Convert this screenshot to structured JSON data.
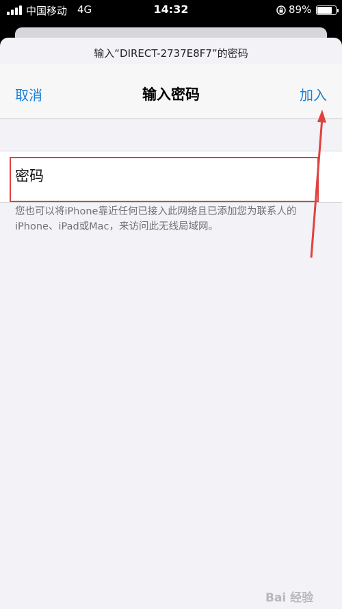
{
  "status_bar": {
    "carrier": "中国移动",
    "network": "4G",
    "time": "14:32",
    "battery": "89%",
    "battery_level": 0.89,
    "icons": [
      "signal-icon",
      "rotation-lock-icon",
      "battery-icon"
    ]
  },
  "dialog": {
    "prompt": "输入“DIRECT-2737E8F7”的密码",
    "nav": {
      "cancel_label": "取消",
      "title": "输入密码",
      "join_label": "加入"
    },
    "password_field": {
      "placeholder": "密码",
      "value": ""
    },
    "footnote": "您也可以将iPhone靠近任何已接入此网络且已添加您为联系人的iPhone、iPad或Mac，来访问此无线局域网。"
  },
  "watermark": "Bai 经验",
  "colors": {
    "accent": "#1a7fd4",
    "annotation_red": "#e0413e",
    "sheet_background": "#f2f2f7"
  }
}
